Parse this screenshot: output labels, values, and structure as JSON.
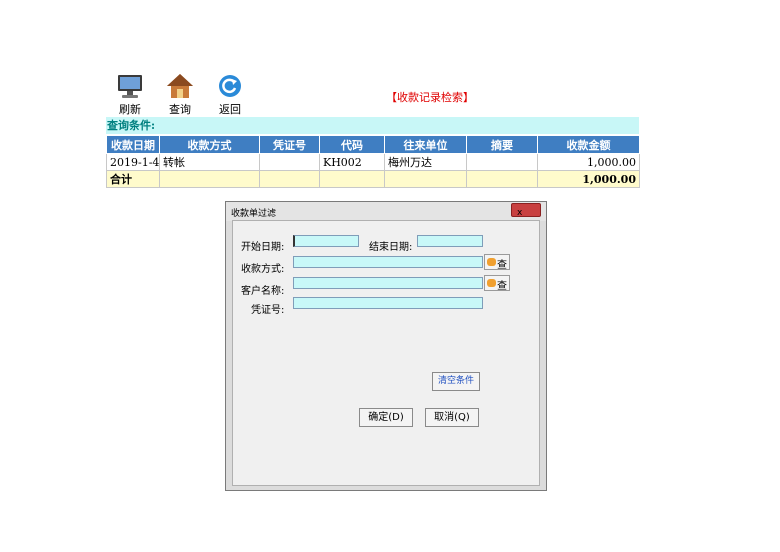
{
  "toolbar": {
    "refresh_label": "刷新",
    "query_label": "查询",
    "back_label": "返回"
  },
  "page_title": "【收款记录检索】",
  "condition_label": "查询条件:",
  "table": {
    "headers": [
      "收款日期",
      "收款方式",
      "凭证号",
      "代码",
      "往来单位",
      "摘要",
      "收款金额"
    ],
    "rows": [
      [
        "2019-1-4",
        "转帐",
        "",
        "KH002",
        "梅州万达",
        "",
        "1,000.00"
      ]
    ],
    "total": {
      "label": "合计",
      "amount": "1,000.00"
    }
  },
  "dialog": {
    "title": "收款单过滤",
    "close_label": "x",
    "start_date_label": "开始日期:",
    "end_date_label": "结束日期:",
    "payment_method_label": "收款方式:",
    "customer_name_label": "客户名称:",
    "voucher_no_label": "凭证号:",
    "query_btn_label": "查",
    "clear_btn_label": "清空条件",
    "ok_btn_label": "确定(D)",
    "cancel_btn_label": "取消(Q)"
  },
  "colors": {
    "header_blue": "#3f7ec2",
    "condition_bg": "#c8f7f7",
    "title_red": "#e00000",
    "total_bg": "#fffbcc",
    "input_bg": "#c8f8f8"
  }
}
